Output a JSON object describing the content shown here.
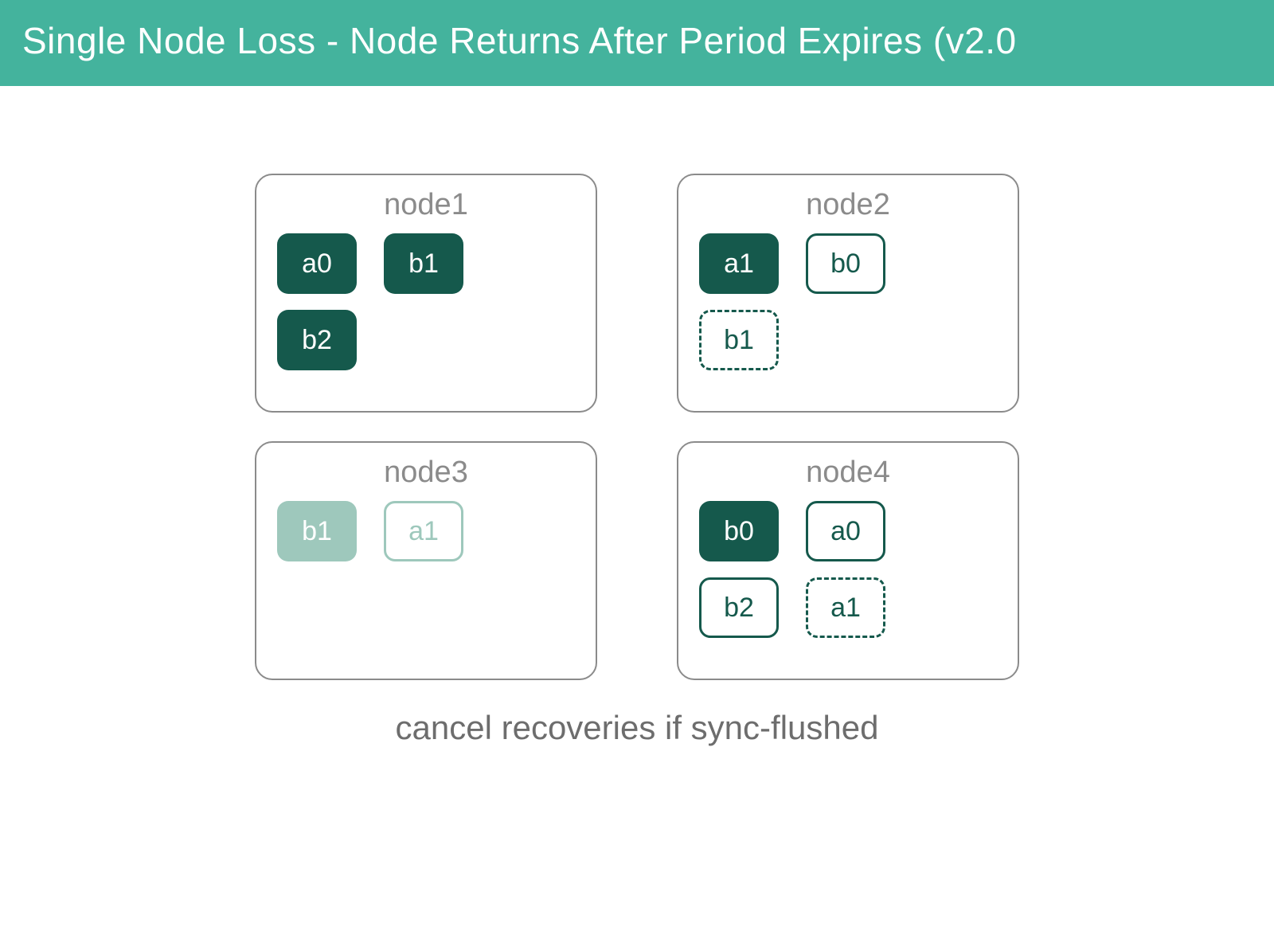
{
  "banner": {
    "title": "Single Node Loss - Node Returns After Period Expires (v2.0"
  },
  "nodes": {
    "n1": {
      "title": "node1",
      "r1s1": "a0",
      "r1s2": "b1",
      "r2s1": "b2"
    },
    "n2": {
      "title": "node2",
      "r1s1": "a1",
      "r1s2": "b0",
      "r2s1": "b1"
    },
    "n3": {
      "title": "node3",
      "r1s1": "b1",
      "r1s2": "a1"
    },
    "n4": {
      "title": "node4",
      "r1s1": "b0",
      "r1s2": "a0",
      "r2s1": "b2",
      "r2s2": "a1"
    }
  },
  "caption": "cancel recoveries if sync-flushed"
}
